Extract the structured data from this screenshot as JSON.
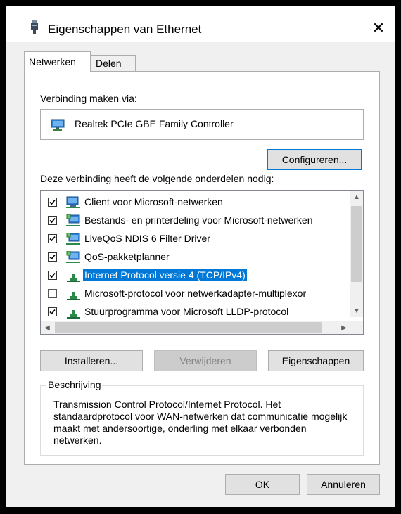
{
  "window": {
    "title": "Eigenschappen van Ethernet",
    "close_glyph": "✕"
  },
  "tabs": [
    {
      "label": "Netwerken",
      "active": true
    },
    {
      "label": "Delen",
      "active": false
    }
  ],
  "connection": {
    "label": "Verbinding maken via:",
    "adapter": "Realtek PCIe GBE Family Controller",
    "configure_button": "Configureren..."
  },
  "components": {
    "label": "Deze verbinding heeft de volgende onderdelen nodig:",
    "items": [
      {
        "label": "Client voor Microsoft-netwerken",
        "checked": true,
        "icon": "network-client-icon",
        "selected": false
      },
      {
        "label": "Bestands- en printerdeling voor Microsoft-netwerken",
        "checked": true,
        "icon": "network-service-icon",
        "selected": false
      },
      {
        "label": "LiveQoS NDIS 6 Filter Driver",
        "checked": true,
        "icon": "network-service-icon",
        "selected": false
      },
      {
        "label": "QoS-pakketplanner",
        "checked": true,
        "icon": "network-service-icon",
        "selected": false
      },
      {
        "label": "Internet Protocol versie 4 (TCP/IPv4)",
        "checked": true,
        "icon": "protocol-icon",
        "selected": true
      },
      {
        "label": "Microsoft-protocol voor netwerkadapter-multiplexor",
        "checked": false,
        "icon": "protocol-icon",
        "selected": false
      },
      {
        "label": "Stuurprogramma voor Microsoft LLDP-protocol",
        "checked": true,
        "icon": "protocol-icon",
        "selected": false
      }
    ]
  },
  "buttons": {
    "install": "Installeren...",
    "remove": "Verwijderen",
    "properties": "Eigenschappen",
    "ok": "OK",
    "cancel": "Annuleren"
  },
  "description": {
    "legend": "Beschrijving",
    "text": "Transmission Control Protocol/Internet Protocol. Het standaardprotocol voor WAN-netwerken dat communicatie mogelijk maakt met andersoortige, onderling met elkaar verbonden netwerken."
  },
  "colors": {
    "selection": "#0078d7",
    "focus_border": "#0078d7"
  }
}
